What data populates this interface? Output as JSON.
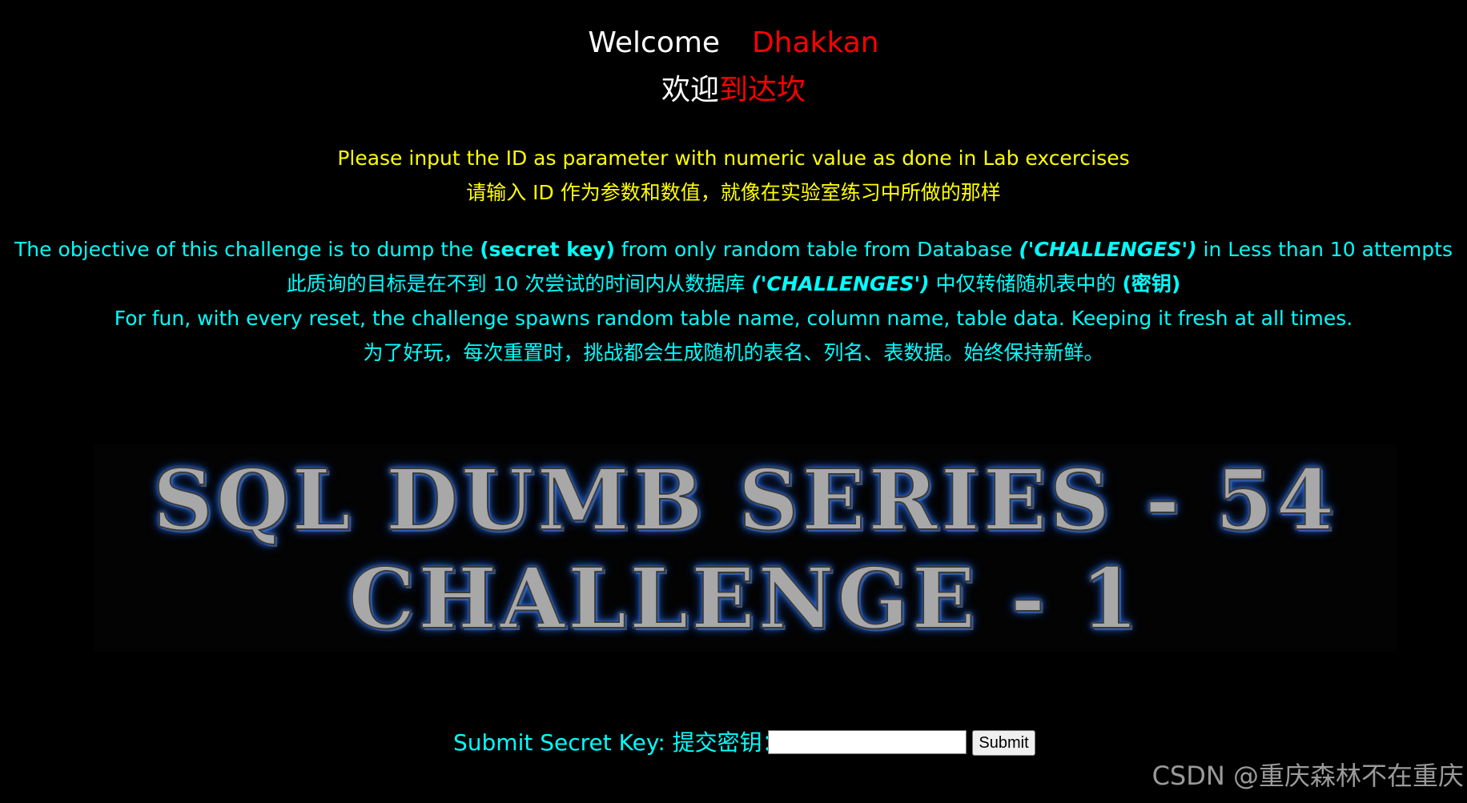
{
  "welcome": {
    "label": "Welcome",
    "name": "Dhakkan",
    "cn_white": "欢迎",
    "cn_red": "到达坎"
  },
  "instructions": {
    "line_en": "Please input the ID as parameter with numeric value as done in Lab excercises",
    "line_cn": "请输入 ID 作为参数和数值，就像在实验室练习中所做的那样"
  },
  "objective": {
    "en_part1": "The objective of this challenge is to dump the ",
    "en_bold": "(secret key)",
    "en_part2": " from only random table from Database ",
    "en_italic": "('CHALLENGES')",
    "en_part3": " in Less than 10 attempts",
    "cn_part1": "此质询的目标是在不到 10 次尝试的时间内从数据库 ",
    "cn_italic": "('CHALLENGES')",
    "cn_part2": " 中仅转储随机表中的 ",
    "cn_bold": "(密钥)",
    "fun_en": "For fun, with every reset, the challenge spawns random table name, column name, table data. Keeping it fresh at all times.",
    "fun_cn": "为了好玩，每次重置时，挑战都会生成随机的表名、列名、表数据。始终保持新鲜。"
  },
  "banner": {
    "line1": "SQL DUMB SERIES - 54",
    "line2": "CHALLENGE - 1"
  },
  "form": {
    "label": "Submit Secret Key:  提交密钥：",
    "input_value": "",
    "submit_label": "Submit"
  },
  "watermark": "CSDN @重庆森林不在重庆",
  "colors": {
    "background": "#000000",
    "yellow": "#ffff00",
    "cyan": "#00ffff",
    "red": "#ff0000",
    "glow": "#2d6fe0"
  }
}
